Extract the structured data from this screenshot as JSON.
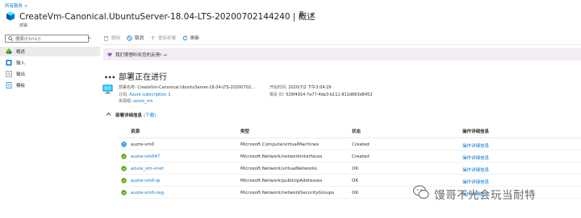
{
  "breadcrumb": {
    "root": "所有服务",
    "sep": ">"
  },
  "header": {
    "title": "CreateVm-Canonical.UbuntuServer-18.04-LTS-20200702144240 | 概述",
    "subtitle": "部署"
  },
  "sidebar": {
    "search_placeholder": "搜索(Ctrl+/)",
    "collapse": "«",
    "items": [
      {
        "label": "概述",
        "icon": "overview-icon",
        "selected": true
      },
      {
        "label": "输入",
        "icon": "input-icon"
      },
      {
        "label": "输出",
        "icon": "output-icon"
      },
      {
        "label": "模板",
        "icon": "template-icon"
      }
    ]
  },
  "toolbar": {
    "delete": "删除",
    "cancel": "取消",
    "redeploy": "重新部署",
    "refresh": "刷新"
  },
  "banner": {
    "text": "我们很想听听您的反馈! →"
  },
  "status": {
    "title": "部署正在进行",
    "name_label": "部署名称:",
    "name_value": "CreateVm-Canonical.UbuntuServer-18.04-LTS-20200702...",
    "sub_label": "订阅:",
    "sub_value": "Azure subscription 1",
    "rg_label": "资源组:",
    "rg_value": "azure_vm",
    "start_label": "开始时间:",
    "start_value": "2020/7/2 下午3:04:29",
    "corr_label": "相关 ID:",
    "corr_value": "526f4914-7a77-4da3-b111-812d663d8452"
  },
  "details": {
    "label": "部署详细信息",
    "download": "(下载)",
    "columns": [
      "资源",
      "类型",
      "状态",
      "操作详细信息"
    ],
    "rows": [
      {
        "resource": "auzre-vm0",
        "link": false,
        "type": "Microsoft.Compute/virtualMachines",
        "state": "Created",
        "op": "操作详细信息",
        "icon": "pending"
      },
      {
        "resource": "auzre-vm047",
        "link": true,
        "type": "Microsoft.Network/networkInterfaces",
        "state": "Created",
        "op": "操作详细信息",
        "icon": "success"
      },
      {
        "resource": "azure_vm-vnet",
        "link": true,
        "type": "Microsoft.Network/virtualNetworks",
        "state": "OK",
        "op": "操作详细信息",
        "icon": "success"
      },
      {
        "resource": "auzre-vm0-ip",
        "link": true,
        "type": "Microsoft.Network/publicIpAddresses",
        "state": "OK",
        "op": "操作详细信息",
        "icon": "success"
      },
      {
        "resource": "auzre-vm0-nsg",
        "link": true,
        "type": "Microsoft.Network/networkSecurityGroups",
        "state": "OK",
        "op": "操作详细信息",
        "icon": "success"
      }
    ]
  },
  "watermark": {
    "text": "馒哥不光会玩当耐特"
  },
  "colors": {
    "link": "#0078d4",
    "success": "#57a300",
    "banner": "#f3ebf5",
    "accent": "#0078d4"
  }
}
